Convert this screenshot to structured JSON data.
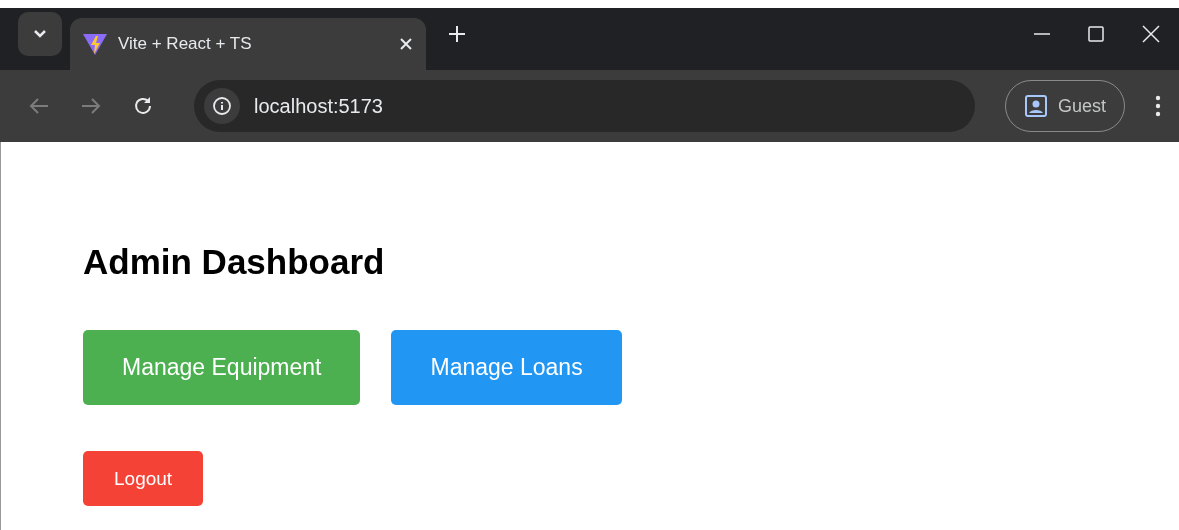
{
  "browser": {
    "tab": {
      "title": "Vite + React + TS",
      "selected": true
    },
    "address": "localhost:5173",
    "profile": "Guest"
  },
  "page": {
    "heading": "Admin Dashboard",
    "actions": [
      {
        "label": "Manage Equipment",
        "color": "#4caf50"
      },
      {
        "label": "Manage Loans",
        "color": "#2196f3"
      }
    ],
    "logout": {
      "label": "Logout",
      "color": "#f44336"
    }
  }
}
